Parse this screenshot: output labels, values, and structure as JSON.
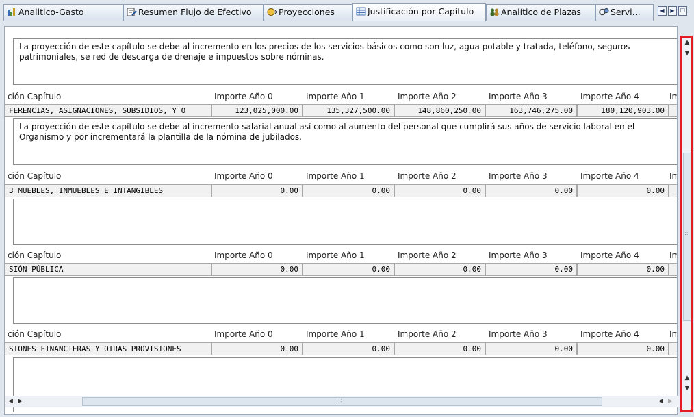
{
  "tabs": [
    {
      "label": "Analitico-Gasto",
      "icon": "chart-icon"
    },
    {
      "label": "Resumen Flujo de Efectivo",
      "icon": "document-edit-icon"
    },
    {
      "label": "Proyecciones",
      "icon": "projection-icon"
    },
    {
      "label": "Justificación por Capítulo",
      "icon": "table-icon",
      "active": true
    },
    {
      "label": "Analítico de Plazas",
      "icon": "people-icon"
    },
    {
      "label": "Servi...",
      "icon": "service-icon"
    }
  ],
  "columns": [
    "ción Capítulo",
    "Importe Año 0",
    "Importe Año 1",
    "Importe Año 2",
    "Importe Año 3",
    "Importe Año 4",
    "Im"
  ],
  "sections": [
    {
      "justification": "La proyección de este capítulo  se debe al incremento en los precios de los servicios básicos como son luz, agua potable y tratada, teléfono, seguros patrimoniales, se red de descarga de drenaje e impuestos sobre nóminas."
    },
    {
      "chapter": "FERENCIAS, ASIGNACIONES, SUBSIDIOS, Y O",
      "amounts": [
        "123,025,000.00",
        "135,327,500.00",
        "148,860,250.00",
        "163,746,275.00",
        "180,120,903.00"
      ],
      "justification": "La proyección de este capítulo  se debe al incremento salarial anual  así como al aumento del personal que cumplirá sus años de servicio laboral en el Organismo y por incrementará la plantilla de la nómina de jubilados."
    },
    {
      "chapter": "3 MUEBLES, INMUEBLES E INTANGIBLES",
      "amounts": [
        "0.00",
        "0.00",
        "0.00",
        "0.00",
        "0.00"
      ],
      "justification": ""
    },
    {
      "chapter": "SIÓN PÚBLICA",
      "amounts": [
        "0.00",
        "0.00",
        "0.00",
        "0.00",
        "0.00"
      ],
      "justification": ""
    },
    {
      "chapter": "SIONES FINANCIERAS Y OTRAS PROVISIONES",
      "amounts": [
        "0.00",
        "0.00",
        "0.00",
        "0.00",
        "0.00"
      ],
      "justification": ""
    }
  ],
  "scrollbar": {
    "hscroll_grip": ":::",
    "vscroll_grip": "::"
  },
  "colors": {
    "highlight": "#e31b23",
    "tab_border": "#8c9eb5"
  }
}
